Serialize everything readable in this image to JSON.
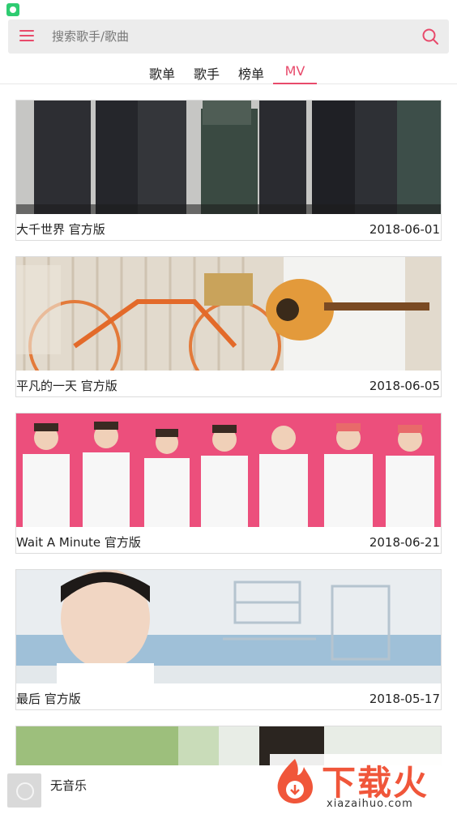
{
  "search": {
    "placeholder": "搜索歌手/歌曲"
  },
  "tabs": [
    {
      "label": "歌单",
      "active": false
    },
    {
      "label": "歌手",
      "active": false
    },
    {
      "label": "榜单",
      "active": false
    },
    {
      "label": "MV",
      "active": true
    }
  ],
  "mv_list": [
    {
      "title": "大千世界 官方版",
      "date": "2018-06-01"
    },
    {
      "title": "平凡的一天 官方版",
      "date": "2018-06-05"
    },
    {
      "title": "Wait A Minute 官方版",
      "date": "2018-06-21"
    },
    {
      "title": "最后 官方版",
      "date": "2018-05-17"
    }
  ],
  "player": {
    "title": "无音乐"
  },
  "watermark": {
    "text": "下载火",
    "sub": "xiazaihuo.com"
  },
  "colors": {
    "accent": "#e84a6b",
    "watermark": "#f0563a"
  },
  "icons": [
    "menu-icon",
    "search-icon",
    "music-disc-icon",
    "app-status-icon",
    "flame-logo-icon"
  ]
}
